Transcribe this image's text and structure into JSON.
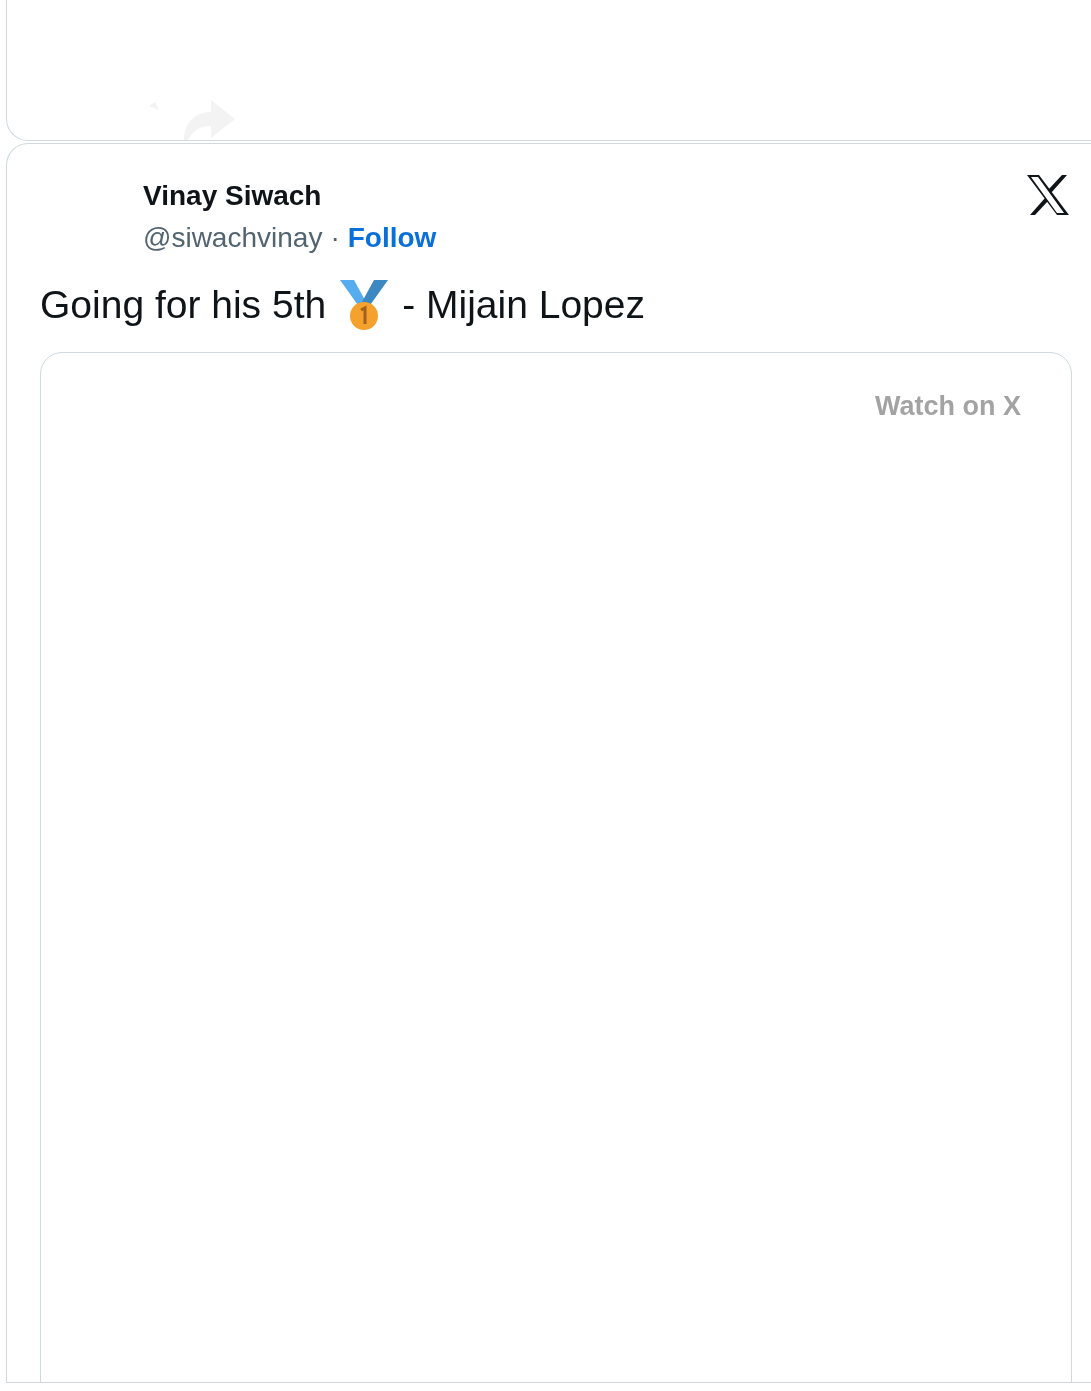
{
  "author": {
    "name": "Vinay Siwach",
    "handle": "@siwachvinay",
    "separator": "·",
    "follow": "Follow"
  },
  "tweet": {
    "text_parts": [
      "Going for his 5th",
      "- Mijain Lopez"
    ]
  },
  "media": {
    "watch_label": "Watch on X"
  }
}
